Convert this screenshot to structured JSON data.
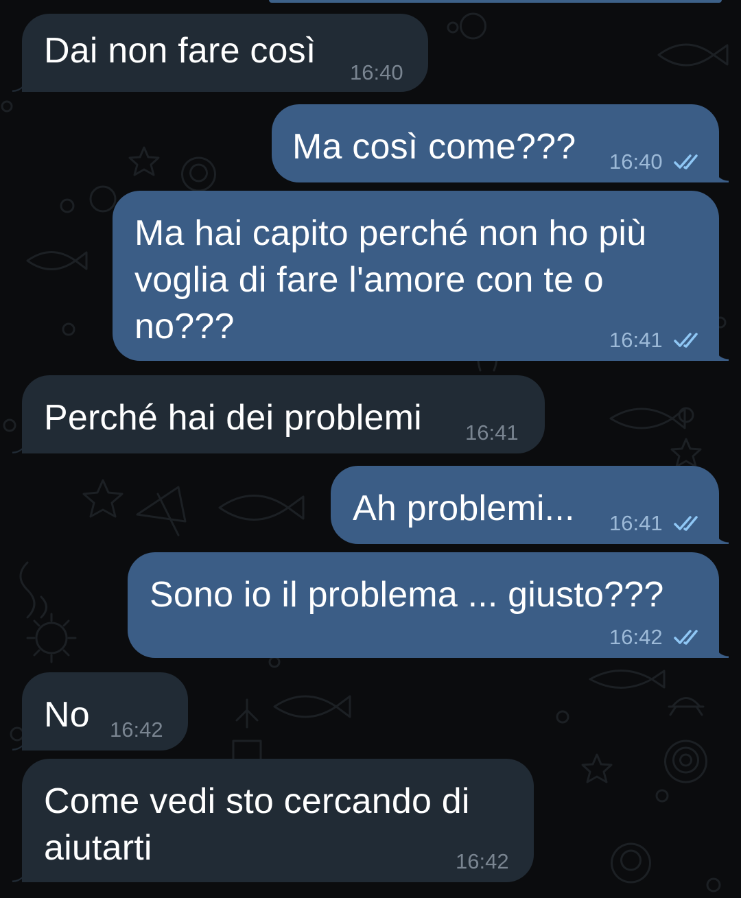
{
  "chat": {
    "colors": {
      "background": "#0b0c0e",
      "incoming_bubble": "#212b35",
      "outgoing_bubble": "#3b5d86",
      "read_ticks": "#8fc7f5"
    },
    "messages": [
      {
        "direction": "incoming",
        "text": "Dai non fare così",
        "time": "16:40"
      },
      {
        "direction": "outgoing",
        "text": "Ma così come???",
        "time": "16:40",
        "status": "read-double-check"
      },
      {
        "direction": "outgoing",
        "lines": [
          "Ma hai capito perché non ho più",
          "voglia di fare l'amore con te o",
          "no???"
        ],
        "time": "16:41",
        "status": "read-double-check"
      },
      {
        "direction": "incoming",
        "text": "Perché hai dei problemi",
        "time": "16:41"
      },
      {
        "direction": "outgoing",
        "text": "Ah problemi...",
        "time": "16:41",
        "status": "read-double-check"
      },
      {
        "direction": "outgoing",
        "text": "Sono io il problema ... giusto???",
        "time": "16:42",
        "status": "read-double-check"
      },
      {
        "direction": "incoming",
        "text": "No",
        "time": "16:42"
      },
      {
        "direction": "incoming",
        "lines": [
          "Come vedi sto cercando di",
          "aiutarti"
        ],
        "time": "16:42"
      }
    ]
  }
}
